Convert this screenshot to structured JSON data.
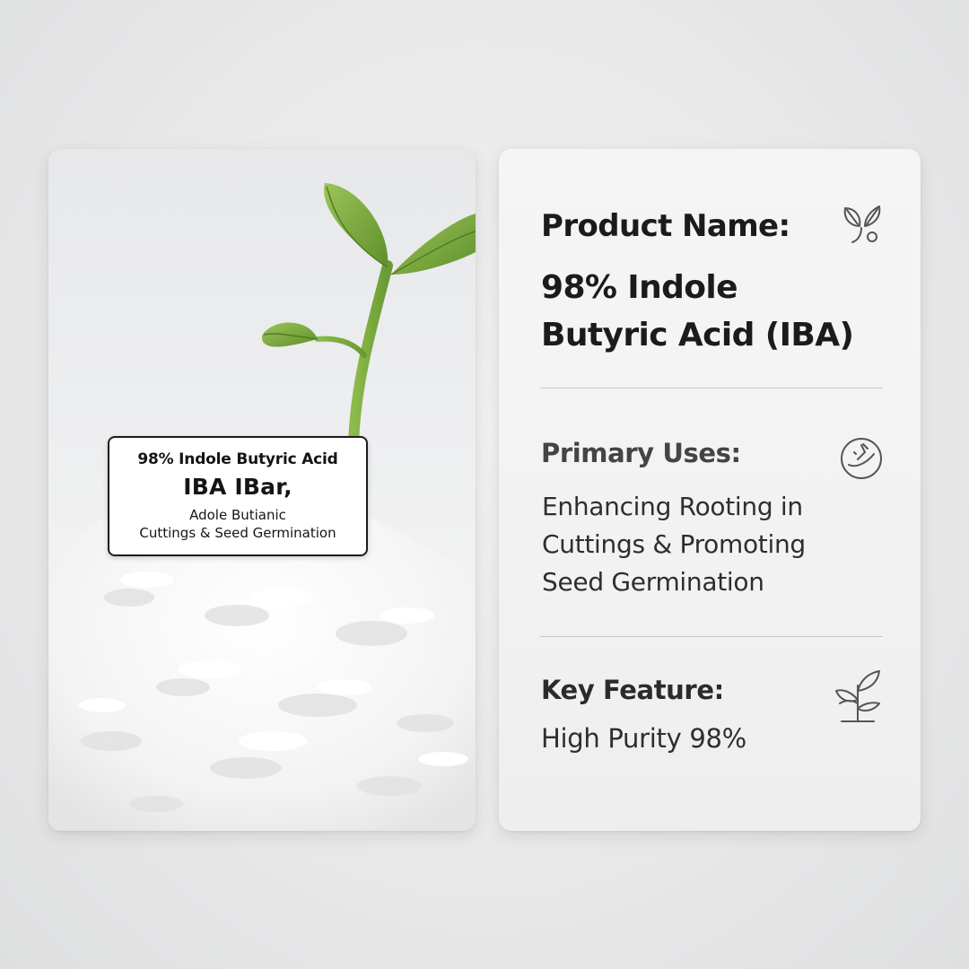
{
  "photo": {
    "label": {
      "line1": "98% Indole Butyric Acid",
      "line2": "IBA IBar,",
      "line3": "Adole Butianic",
      "line4": "Cuttings & Seed Germination"
    }
  },
  "info": {
    "product_heading": "Product Name:",
    "product_name_line1": "98% Indole",
    "product_name_line2": "Butyric Acid (IBA)",
    "uses_heading": "Primary Uses:",
    "uses_line1": "Enhancing Rooting in",
    "uses_line2": "Cuttings & Promoting",
    "uses_line3": "Seed Germination",
    "feature_heading": "Key Feature:",
    "feature_text": "High Purity 98%"
  },
  "icons": {
    "product": "leaf-plant-icon",
    "uses": "dropper-circle-icon",
    "feature": "sprout-icon"
  },
  "colors": {
    "leaf": "#7aa83c",
    "powder": "#f7f7f7",
    "text": "#1b1b1b"
  }
}
